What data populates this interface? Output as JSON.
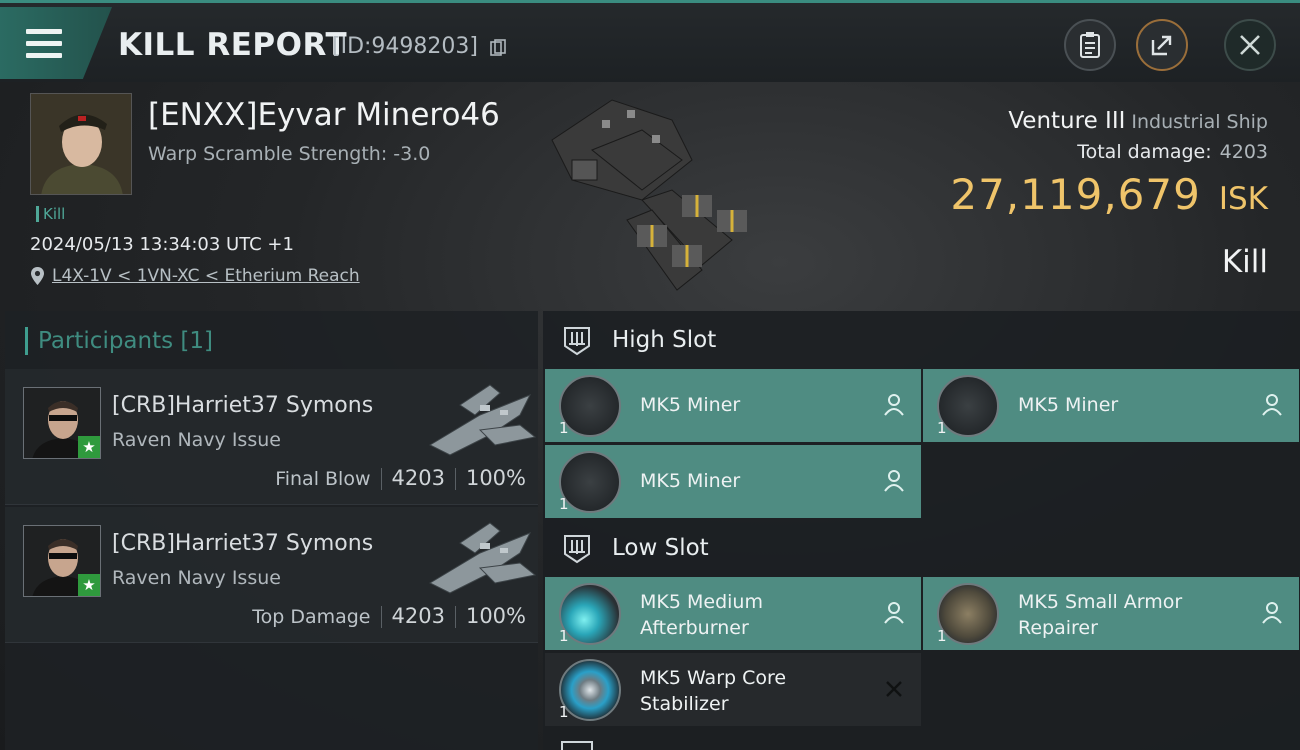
{
  "header": {
    "title": "KILL REPORT",
    "report_id": "[ID:9498203]",
    "menu_icon": "hamburger-menu-icon",
    "actions": [
      {
        "name": "clipboard-icon"
      },
      {
        "name": "share-icon"
      },
      {
        "name": "close-icon"
      }
    ]
  },
  "victim": {
    "name": "[ENXX]Eyvar Minero46",
    "warp_scramble": "Warp Scramble Strength: -3.0",
    "tag": "Kill",
    "timestamp": "2024/05/13 13:34:03 UTC +1",
    "location": "L4X-1V < 1VN-XC < Etherium Reach",
    "ship_name": "Venture III",
    "ship_class": "Industrial Ship",
    "total_damage_label": "Total damage:",
    "total_damage": "4203",
    "isk_value": "27,119,679",
    "isk_unit": "ISK",
    "result": "Kill"
  },
  "participants": {
    "title": "Participants",
    "count": "[1]",
    "rows": [
      {
        "name": "[CRB]Harriet37 Symons",
        "ship": "Raven Navy Issue",
        "label": "Final Blow",
        "damage": "4203",
        "percent": "100%"
      },
      {
        "name": "[CRB]Harriet37 Symons",
        "ship": "Raven Navy Issue",
        "label": "Top Damage",
        "damage": "4203",
        "percent": "100%"
      }
    ]
  },
  "fitting": {
    "high_slot_label": "High Slot",
    "low_slot_label": "Low Slot",
    "high_modules": [
      {
        "name": "MK5 Miner",
        "qty": "1",
        "state": "pilot-icon"
      },
      {
        "name": "MK5 Miner",
        "qty": "1",
        "state": "pilot-icon"
      },
      {
        "name": "MK5 Miner",
        "qty": "1",
        "state": "pilot-icon"
      }
    ],
    "low_modules": [
      {
        "name_line1": "MK5 Medium",
        "name_line2": "Afterburner",
        "qty": "1",
        "state": "pilot-icon"
      },
      {
        "name_line1": "MK5 Small Armor",
        "name_line2": "Repairer",
        "qty": "1",
        "state": "pilot-icon"
      },
      {
        "name_line1": "MK5 Warp Core",
        "name_line2": "Stabilizer",
        "qty": "1",
        "state": "destroyed-x-icon"
      }
    ]
  },
  "colors": {
    "accent_teal": "#4f8c82",
    "isk_gold": "#efc46a",
    "final_star_green": "#2f9a3d"
  }
}
